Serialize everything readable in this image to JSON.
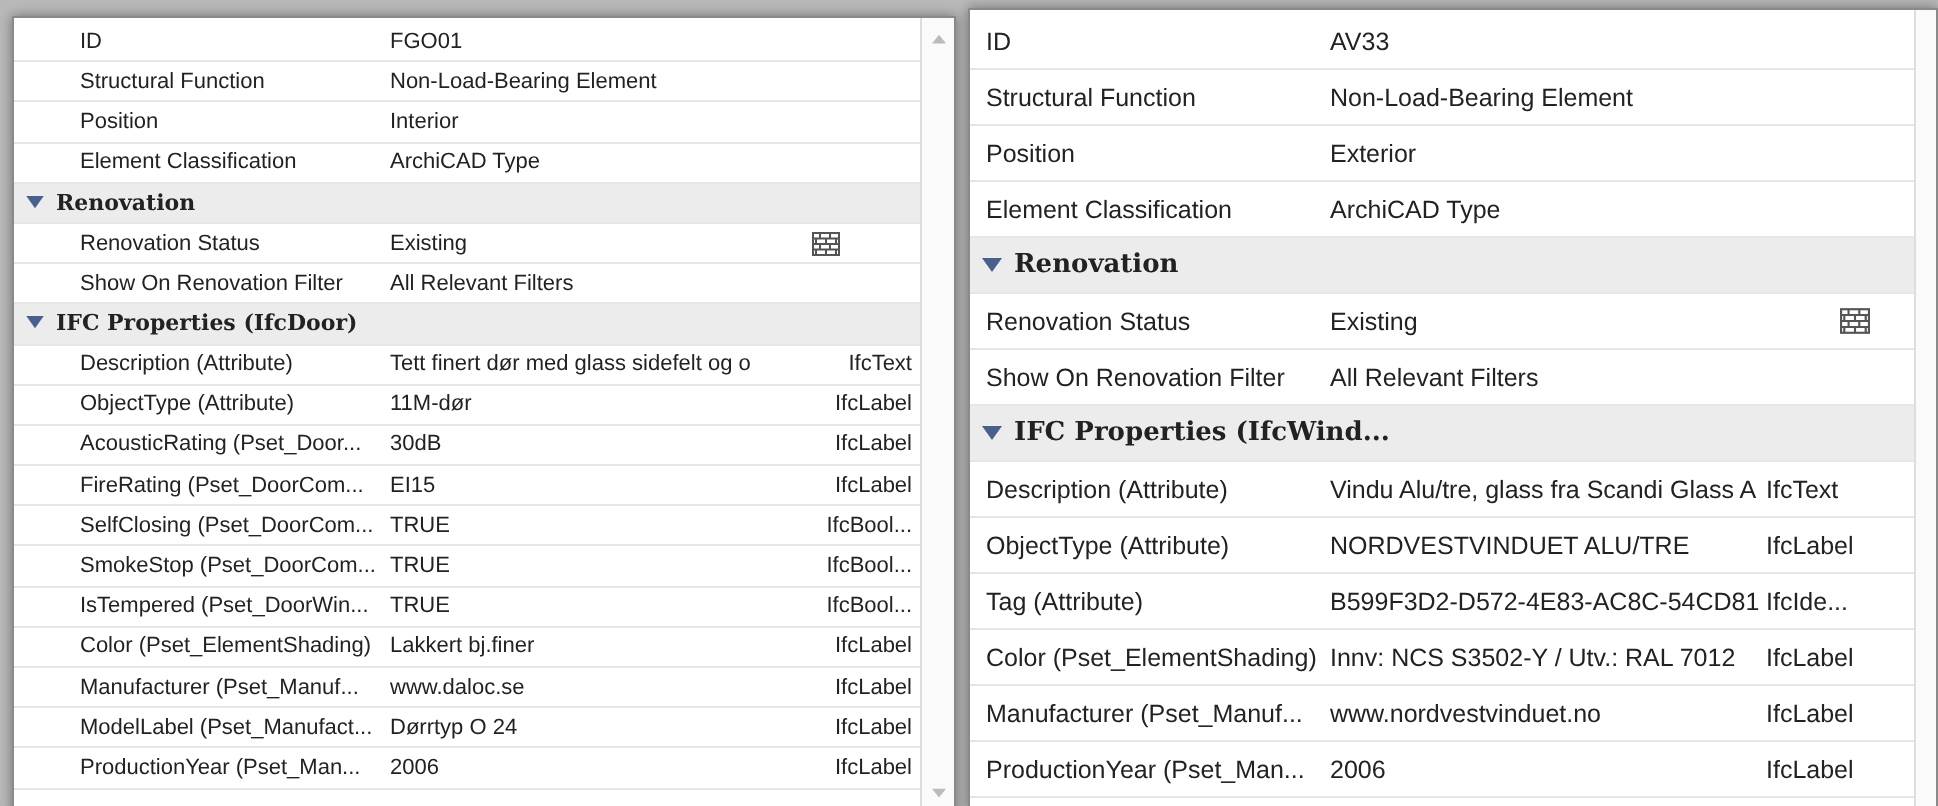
{
  "panels": [
    {
      "rows": [
        {
          "kind": "property",
          "name": "ID",
          "value": "FGO01"
        },
        {
          "kind": "property",
          "name": "Structural Function",
          "value": "Non-Load-Bearing Element"
        },
        {
          "kind": "property",
          "name": "Position",
          "value": "Interior"
        },
        {
          "kind": "property",
          "name": "Element Classification",
          "value": "ArchiCAD Type"
        },
        {
          "kind": "group",
          "title": "Renovation",
          "expanded": true
        },
        {
          "kind": "pattern",
          "name": "Renovation Status",
          "value": "Existing"
        },
        {
          "kind": "property",
          "name": "Show On Renovation Filter",
          "value": "All Relevant Filters"
        },
        {
          "kind": "group",
          "title": "IFC Properties (IfcDoor)",
          "expanded": true
        },
        {
          "kind": "property",
          "name": "Description (Attribute)",
          "value": "Tett finert dør med glass sidefelt og o",
          "type": "IfcText"
        },
        {
          "kind": "property",
          "name": "ObjectType (Attribute)",
          "value": "11M-dør",
          "type": "IfcLabel"
        },
        {
          "kind": "property",
          "name": "AcousticRating (Pset_Door...",
          "value": "30dB",
          "type": "IfcLabel"
        },
        {
          "kind": "property",
          "name": "FireRating (Pset_DoorCom...",
          "value": "EI15",
          "type": "IfcLabel"
        },
        {
          "kind": "property",
          "name": "SelfClosing (Pset_DoorCom...",
          "value": "TRUE",
          "type": "IfcBool..."
        },
        {
          "kind": "property",
          "name": "SmokeStop (Pset_DoorCom...",
          "value": "TRUE",
          "type": "IfcBool..."
        },
        {
          "kind": "property",
          "name": "IsTempered (Pset_DoorWin...",
          "value": "TRUE",
          "type": "IfcBool..."
        },
        {
          "kind": "property",
          "name": "Color (Pset_ElementShading)",
          "value": "Lakkert bj.finer",
          "type": "IfcLabel"
        },
        {
          "kind": "property",
          "name": "Manufacturer (Pset_Manuf...",
          "value": "www.daloc.se",
          "type": "IfcLabel"
        },
        {
          "kind": "property",
          "name": "ModelLabel (Pset_Manufact...",
          "value": "Dørrtyp O 24",
          "type": "IfcLabel"
        },
        {
          "kind": "property",
          "name": "ProductionYear (Pset_Man...",
          "value": "2006",
          "type": "IfcLabel"
        }
      ]
    },
    {
      "rows": [
        {
          "kind": "property",
          "name": "ID",
          "value": "AV33"
        },
        {
          "kind": "property",
          "name": "Structural Function",
          "value": "Non-Load-Bearing Element"
        },
        {
          "kind": "property",
          "name": "Position",
          "value": "Exterior"
        },
        {
          "kind": "property",
          "name": "Element Classification",
          "value": "ArchiCAD Type"
        },
        {
          "kind": "group",
          "title": "Renovation",
          "expanded": true
        },
        {
          "kind": "pattern",
          "name": "Renovation Status",
          "value": "Existing"
        },
        {
          "kind": "property",
          "name": "Show On Renovation Filter",
          "value": "All Relevant Filters"
        },
        {
          "kind": "group",
          "title": "IFC Properties (IfcWind...",
          "expanded": true
        },
        {
          "kind": "property",
          "name": "Description (Attribute)",
          "value": "Vindu Alu/tre, glass fra Scandi Glass A",
          "type": "IfcText"
        },
        {
          "kind": "property",
          "name": "ObjectType (Attribute)",
          "value": "NORDVESTVINDUET ALU/TRE",
          "type": "IfcLabel"
        },
        {
          "kind": "property",
          "name": "Tag (Attribute)",
          "value": "B599F3D2-D572-4E83-AC8C-54CD81",
          "type": "IfcIde..."
        },
        {
          "kind": "property",
          "name": "Color (Pset_ElementShading)",
          "value": "Innv: NCS S3502-Y / Utv.: RAL 7012",
          "type": "IfcLabel"
        },
        {
          "kind": "property",
          "name": "Manufacturer (Pset_Manuf...",
          "value": "www.nordvestvinduet.no",
          "type": "IfcLabel"
        },
        {
          "kind": "property",
          "name": "ProductionYear (Pset_Man...",
          "value": "2006",
          "type": "IfcLabel"
        }
      ]
    }
  ]
}
